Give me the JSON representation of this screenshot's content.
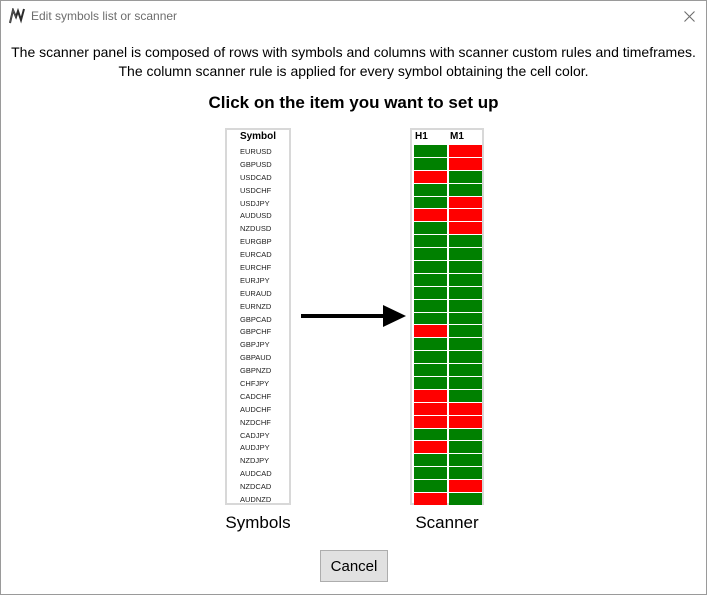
{
  "window": {
    "title": "Edit symbols list or scanner",
    "app_icon": "chart-logo-icon",
    "close_icon": "close-icon"
  },
  "description": {
    "line1": "The scanner panel is composed of rows with symbols and columns with scanner custom rules and timeframes.",
    "line2": "The column scanner rule is applied for every symbol obtaining the cell color."
  },
  "heading": "Click on the item you want to set up",
  "symbols_panel": {
    "header": "Symbol",
    "caption": "Symbols",
    "items": [
      "EURUSD",
      "GBPUSD",
      "USDCAD",
      "USDCHF",
      "USDJPY",
      "AUDUSD",
      "NZDUSD",
      "EURGBP",
      "EURCAD",
      "EURCHF",
      "EURJPY",
      "EURAUD",
      "EURNZD",
      "GBPCAD",
      "GBPCHF",
      "GBPJPY",
      "GBPAUD",
      "GBPNZD",
      "CHFJPY",
      "CADCHF",
      "AUDCHF",
      "NZDCHF",
      "CADJPY",
      "AUDJPY",
      "NZDJPY",
      "AUDCAD",
      "NZDCAD",
      "AUDNZD"
    ]
  },
  "scanner_panel": {
    "columns": [
      "H1",
      "M1"
    ],
    "caption": "Scanner",
    "cells": [
      [
        "g",
        "r"
      ],
      [
        "g",
        "r"
      ],
      [
        "r",
        "g"
      ],
      [
        "g",
        "g"
      ],
      [
        "g",
        "r"
      ],
      [
        "r",
        "r"
      ],
      [
        "g",
        "r"
      ],
      [
        "g",
        "g"
      ],
      [
        "g",
        "g"
      ],
      [
        "g",
        "g"
      ],
      [
        "g",
        "g"
      ],
      [
        "g",
        "g"
      ],
      [
        "g",
        "g"
      ],
      [
        "g",
        "g"
      ],
      [
        "r",
        "g"
      ],
      [
        "g",
        "g"
      ],
      [
        "g",
        "g"
      ],
      [
        "g",
        "g"
      ],
      [
        "g",
        "g"
      ],
      [
        "r",
        "g"
      ],
      [
        "r",
        "r"
      ],
      [
        "r",
        "r"
      ],
      [
        "g",
        "g"
      ],
      [
        "r",
        "g"
      ],
      [
        "g",
        "g"
      ],
      [
        "g",
        "g"
      ],
      [
        "g",
        "r"
      ],
      [
        "r",
        "g"
      ]
    ]
  },
  "colors": {
    "green": "#008000",
    "red": "#ff0000",
    "arrow": "#000000"
  },
  "cancel_label": "Cancel"
}
